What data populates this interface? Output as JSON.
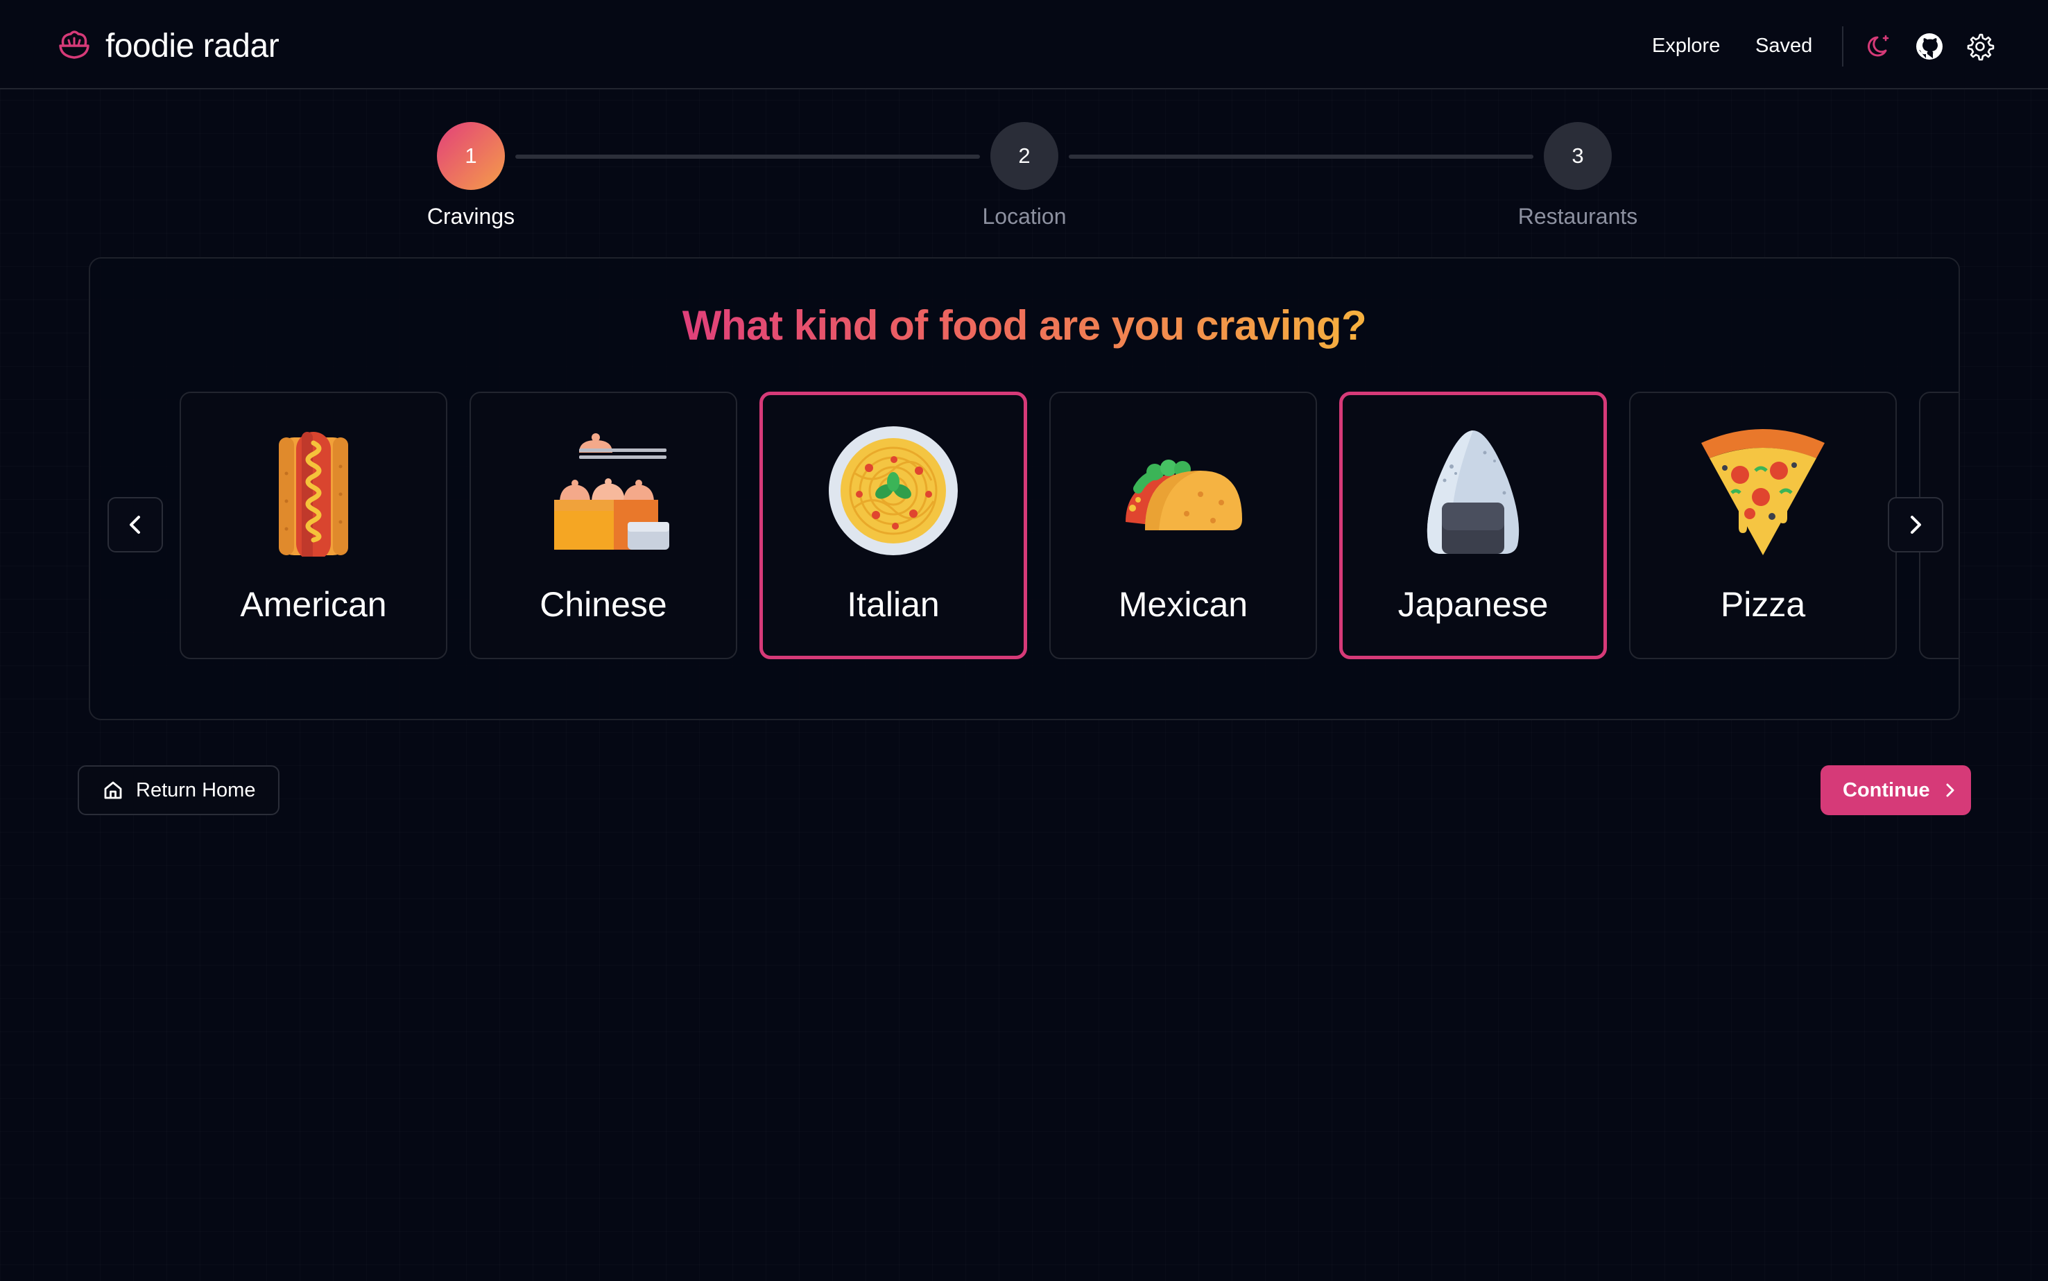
{
  "header": {
    "brand_name": "foodie radar",
    "brand_icon": "bowl-icon",
    "nav": {
      "explore": "Explore",
      "saved": "Saved"
    },
    "icons": [
      "theme-toggle-moon-icon",
      "github-icon",
      "settings-gear-icon"
    ],
    "accent_color": "#d63a78"
  },
  "stepper": {
    "current_step": 1,
    "steps": [
      {
        "number": "1",
        "label": "Cravings",
        "state": "active"
      },
      {
        "number": "2",
        "label": "Location",
        "state": "inactive"
      },
      {
        "number": "3",
        "label": "Restaurants",
        "state": "inactive"
      }
    ]
  },
  "main": {
    "headline": "What kind of food are you craving?",
    "cuisines": [
      {
        "label": "American",
        "icon": "hotdog-icon",
        "selected": false
      },
      {
        "label": "Chinese",
        "icon": "dumplings-icon",
        "selected": false
      },
      {
        "label": "Italian",
        "icon": "spaghetti-plate-icon",
        "selected": true
      },
      {
        "label": "Mexican",
        "icon": "taco-icon",
        "selected": false
      },
      {
        "label": "Japanese",
        "icon": "onigiri-icon",
        "selected": true
      },
      {
        "label": "Pizza",
        "icon": "pizza-slice-icon",
        "selected": false
      }
    ],
    "carousel_prev_icon": "chevron-left-icon",
    "carousel_next_icon": "chevron-right-icon"
  },
  "actions": {
    "return_home": "Return Home",
    "return_home_icon": "home-icon",
    "continue": "Continue",
    "continue_icon": "chevron-right-icon"
  }
}
